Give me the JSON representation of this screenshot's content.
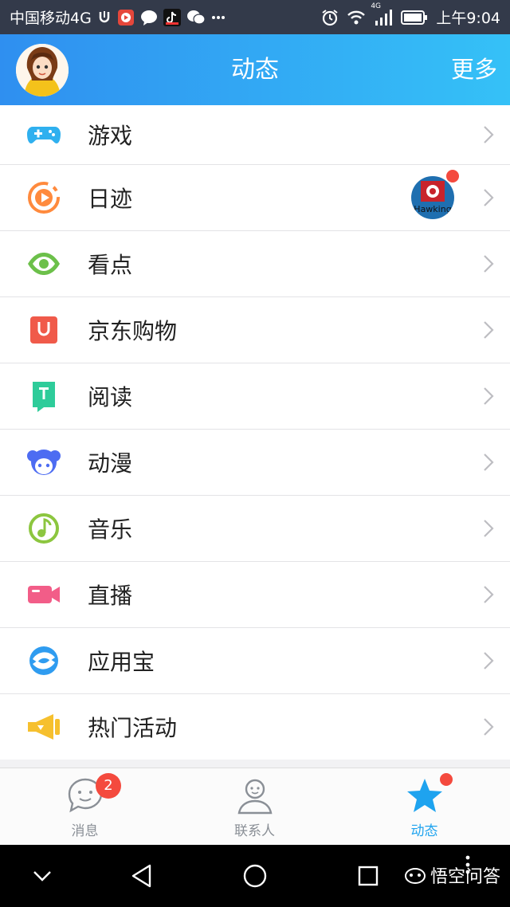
{
  "status_bar": {
    "carrier": "中国移动4G",
    "time": "上午9:04",
    "network_badge": "4G",
    "icons": [
      "usb-icon",
      "video-app-icon",
      "message-bubble-icon",
      "tiktok-icon",
      "wechat-icon",
      "more-notifications-icon",
      "alarm-icon",
      "wifi-icon",
      "signal-icon",
      "battery-icon"
    ]
  },
  "header": {
    "title": "动态",
    "more_label": "更多"
  },
  "menu": {
    "items": [
      {
        "label": "游戏",
        "icon": "gamepad-icon",
        "color": "#2fb0ef"
      },
      {
        "label": "日迹",
        "icon": "daily-trace-icon",
        "color": "#ff8a3d"
      },
      {
        "label": "看点",
        "icon": "eye-icon",
        "color": "#6cc04a"
      },
      {
        "label": "京东购物",
        "icon": "shopping-bag-icon",
        "color": "#f05a4a"
      },
      {
        "label": "阅读",
        "icon": "book-icon",
        "color": "#2ecc9a"
      },
      {
        "label": "动漫",
        "icon": "anime-face-icon",
        "color": "#4d6cf2"
      },
      {
        "label": "音乐",
        "icon": "music-note-icon",
        "color": "#8cc63f"
      },
      {
        "label": "直播",
        "icon": "video-camera-icon",
        "color": "#f25d88"
      },
      {
        "label": "应用宝",
        "icon": "app-store-icon",
        "color": "#2f9cf0"
      },
      {
        "label": "热门活动",
        "icon": "megaphone-icon",
        "color": "#f6c02e"
      }
    ],
    "trace_thumbnail_text": "Hawking"
  },
  "tab_bar": {
    "tabs": [
      {
        "label": "消息",
        "icon": "chat-bubble-icon",
        "badge": "2",
        "active": false
      },
      {
        "label": "联系人",
        "icon": "contact-person-icon",
        "active": false
      },
      {
        "label": "动态",
        "icon": "star-icon",
        "active": true
      }
    ],
    "active_color": "#1ea3ef",
    "inactive_color": "#8a8f96"
  },
  "nav_bar": {
    "buttons": [
      "collapse-icon",
      "back-icon",
      "home-icon",
      "recents-icon"
    ]
  },
  "watermark": {
    "text": "悟空问答"
  }
}
